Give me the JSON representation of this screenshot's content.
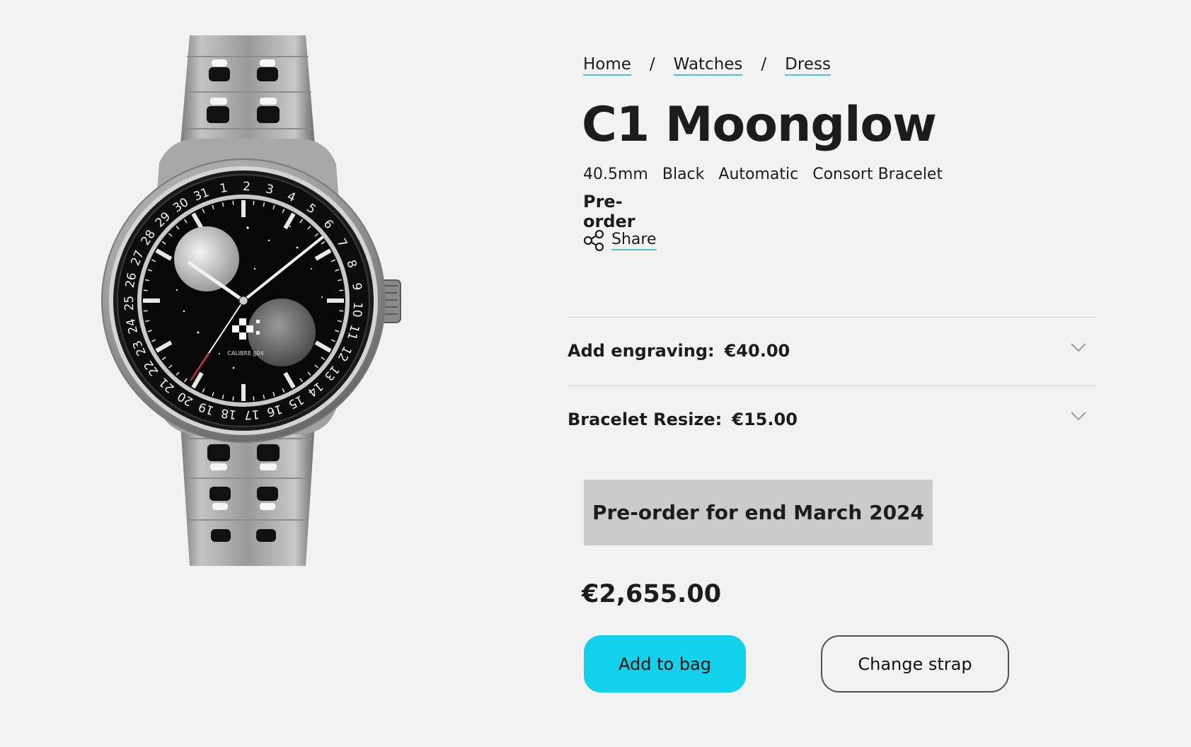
{
  "breadcrumb": {
    "home": "Home",
    "watches": "Watches",
    "dress": "Dress",
    "separator": "/"
  },
  "product": {
    "title": "C1 Moonglow",
    "specs": [
      "40.5mm",
      "Black",
      "Automatic",
      "Consort Bracelet"
    ],
    "status": "Pre-order",
    "share_label": "Share"
  },
  "options": [
    {
      "label": "Add engraving:",
      "price": "€40.00"
    },
    {
      "label": "Bracelet Resize:",
      "price": "€15.00"
    }
  ],
  "preorder_banner": "Pre-order for end March 2024",
  "price": "€2,655.00",
  "actions": {
    "add_to_bag": "Add to bag",
    "change_strap": "Change strap"
  },
  "watch": {
    "dial_text": "CALIBRE JJ04",
    "date_numerals": [
      "1",
      "2",
      "3",
      "4",
      "5",
      "6",
      "7",
      "8",
      "9",
      "10",
      "11",
      "12",
      "13",
      "14",
      "15",
      "16",
      "17",
      "18",
      "19",
      "20",
      "21",
      "22",
      "23",
      "24",
      "25",
      "26",
      "27",
      "28",
      "29",
      "30",
      "31"
    ]
  },
  "colors": {
    "accent": "#12d1eb",
    "link_underline": "#4fc3cf",
    "banner": "#cbcbcb",
    "background": "#f2f2f2"
  },
  "icons": {
    "share": "share-icon",
    "chevron": "chevron-down-icon"
  }
}
